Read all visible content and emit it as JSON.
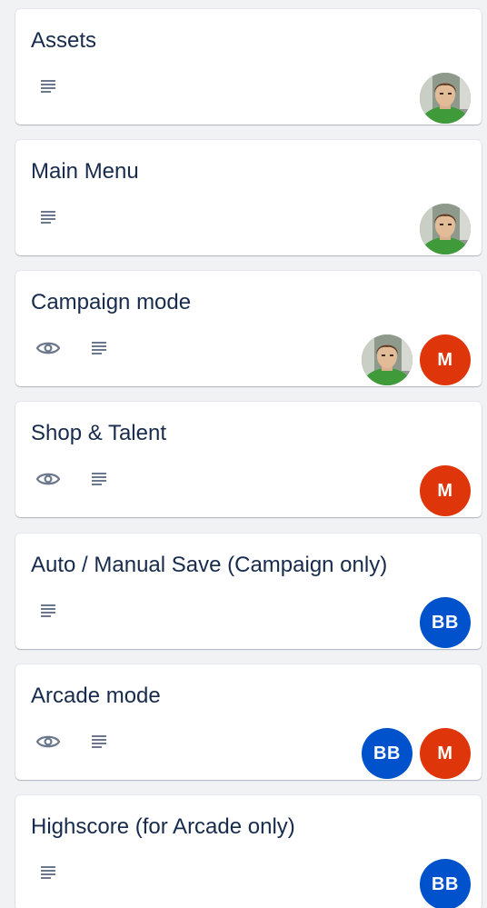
{
  "colors": {
    "background": "#f1f2f4",
    "card": "#ffffff",
    "text": "#172b4d",
    "icon": "#6b778c",
    "member_m": "#de350b",
    "member_bb": "#0052cc"
  },
  "cards": [
    {
      "title": "Assets",
      "badges": [
        "description-icon"
      ],
      "members": [
        {
          "type": "photo",
          "initials": ""
        }
      ]
    },
    {
      "title": "Main Menu",
      "badges": [
        "description-icon"
      ],
      "members": [
        {
          "type": "photo",
          "initials": ""
        }
      ]
    },
    {
      "title": "Campaign mode",
      "badges": [
        "watch-icon",
        "description-icon"
      ],
      "members": [
        {
          "type": "photo",
          "initials": ""
        },
        {
          "type": "initials",
          "initials": "M"
        }
      ]
    },
    {
      "title": "Shop & Talent",
      "badges": [
        "watch-icon",
        "description-icon"
      ],
      "members": [
        {
          "type": "initials",
          "initials": "M"
        }
      ]
    },
    {
      "title": "Auto / Manual Save (Campaign only)",
      "badges": [
        "description-icon"
      ],
      "members": [
        {
          "type": "initials",
          "initials": "BB"
        }
      ]
    },
    {
      "title": "Arcade mode",
      "badges": [
        "watch-icon",
        "description-icon"
      ],
      "members": [
        {
          "type": "initials",
          "initials": "BB"
        },
        {
          "type": "initials",
          "initials": "M"
        }
      ]
    },
    {
      "title": "Highscore (for Arcade only)",
      "badges": [
        "description-icon"
      ],
      "members": [
        {
          "type": "initials",
          "initials": "BB"
        }
      ]
    }
  ]
}
